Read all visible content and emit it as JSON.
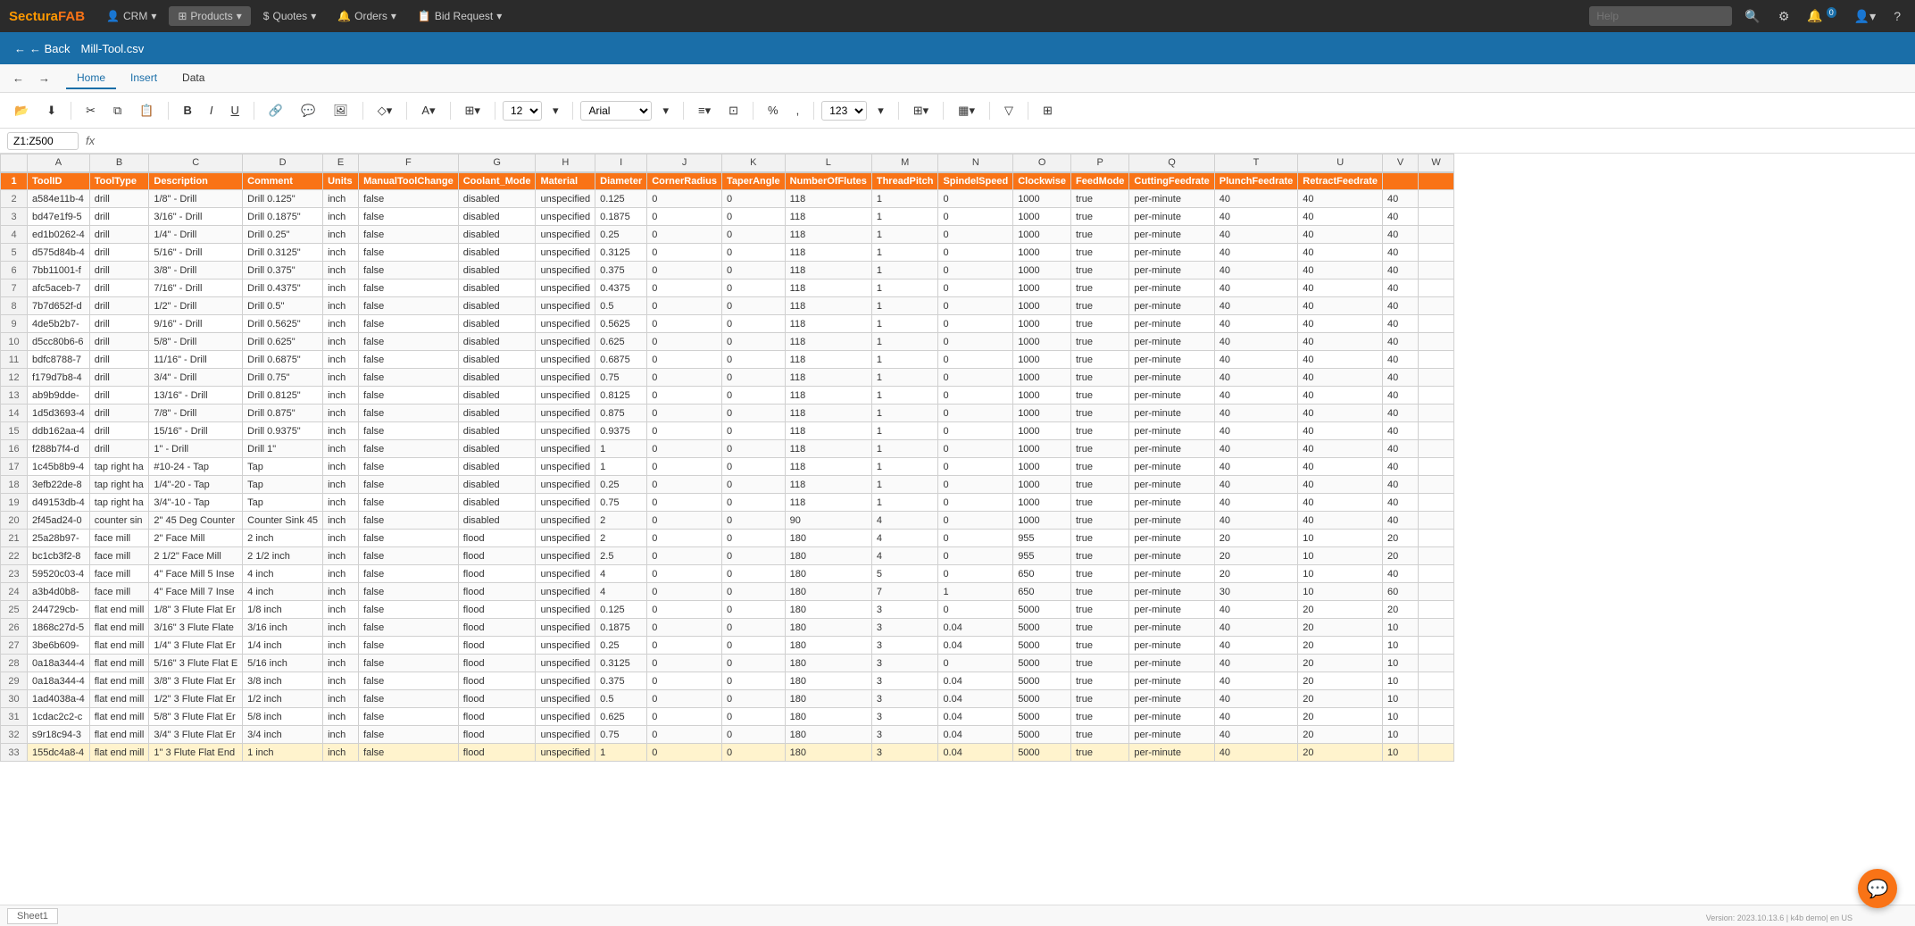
{
  "nav": {
    "logo_text": "Sectura",
    "logo_accent": "FAB",
    "items": [
      {
        "label": "CRM",
        "icon": "▾"
      },
      {
        "label": "Products",
        "icon": "▾"
      },
      {
        "label": "Quotes",
        "icon": "▾"
      },
      {
        "label": "Orders",
        "icon": "▾"
      },
      {
        "label": "Bid Request",
        "icon": "▾"
      }
    ],
    "search_placeholder": "Help",
    "notification_count": "0"
  },
  "breadcrumb": {
    "back_label": "← Back",
    "file_name": "Mill-Tool.csv"
  },
  "ribbon": {
    "tabs": [
      "Home",
      "Insert",
      "Data"
    ],
    "active_tab": "Home"
  },
  "formula_bar": {
    "cell_ref": "Z1:Z500",
    "fx": "fx"
  },
  "columns": {
    "letters": [
      "A",
      "B",
      "C",
      "D",
      "E",
      "F",
      "G",
      "H",
      "I",
      "J",
      "K",
      "L",
      "M",
      "N",
      "O",
      "P",
      "Q",
      "T",
      "U",
      "V",
      "W"
    ],
    "headers": [
      "ToolID",
      "ToolType",
      "Description",
      "Comment",
      "Units",
      "ManualToolChange",
      "Coolant_Mode",
      "Material",
      "Diameter",
      "CornerRadius",
      "TaperAngle",
      "NumberOfFlutes",
      "ThreadPitch",
      "SpindelSpeed",
      "Clockwise",
      "FeedMode",
      "CuttingFeedrate",
      "PlunchFeedrate",
      "RetractFeedrate",
      "",
      ""
    ]
  },
  "rows": [
    {
      "num": 2,
      "a": "a584e11b-4",
      "b": "drill",
      "c": "1/8\" - Drill",
      "d": "Drill 0.125\"",
      "e": "inch",
      "f": "false",
      "g": "disabled",
      "h": "unspecified",
      "i": "0.125",
      "j": "0",
      "k": "0",
      "l": "118",
      "m": "1",
      "n": "0",
      "o": "1000",
      "p": "true",
      "q": "per-minute",
      "t": "40",
      "u": "40",
      "v": "40"
    },
    {
      "num": 3,
      "a": "bd47e1f9-5",
      "b": "drill",
      "c": "3/16\" - Drill",
      "d": "Drill 0.1875\"",
      "e": "inch",
      "f": "false",
      "g": "disabled",
      "h": "unspecified",
      "i": "0.1875",
      "j": "0",
      "k": "0",
      "l": "118",
      "m": "1",
      "n": "0",
      "o": "1000",
      "p": "true",
      "q": "per-minute",
      "t": "40",
      "u": "40",
      "v": "40"
    },
    {
      "num": 4,
      "a": "ed1b0262-4",
      "b": "drill",
      "c": "1/4\" - Drill",
      "d": "Drill 0.25\"",
      "e": "inch",
      "f": "false",
      "g": "disabled",
      "h": "unspecified",
      "i": "0.25",
      "j": "0",
      "k": "0",
      "l": "118",
      "m": "1",
      "n": "0",
      "o": "1000",
      "p": "true",
      "q": "per-minute",
      "t": "40",
      "u": "40",
      "v": "40"
    },
    {
      "num": 5,
      "a": "d575d84b-4",
      "b": "drill",
      "c": "5/16\" - Drill",
      "d": "Drill 0.3125\"",
      "e": "inch",
      "f": "false",
      "g": "disabled",
      "h": "unspecified",
      "i": "0.3125",
      "j": "0",
      "k": "0",
      "l": "118",
      "m": "1",
      "n": "0",
      "o": "1000",
      "p": "true",
      "q": "per-minute",
      "t": "40",
      "u": "40",
      "v": "40"
    },
    {
      "num": 6,
      "a": "7bb11001-f",
      "b": "drill",
      "c": "3/8\" - Drill",
      "d": "Drill 0.375\"",
      "e": "inch",
      "f": "false",
      "g": "disabled",
      "h": "unspecified",
      "i": "0.375",
      "j": "0",
      "k": "0",
      "l": "118",
      "m": "1",
      "n": "0",
      "o": "1000",
      "p": "true",
      "q": "per-minute",
      "t": "40",
      "u": "40",
      "v": "40"
    },
    {
      "num": 7,
      "a": "afc5aceb-7",
      "b": "drill",
      "c": "7/16\" - Drill",
      "d": "Drill 0.4375\"",
      "e": "inch",
      "f": "false",
      "g": "disabled",
      "h": "unspecified",
      "i": "0.4375",
      "j": "0",
      "k": "0",
      "l": "118",
      "m": "1",
      "n": "0",
      "o": "1000",
      "p": "true",
      "q": "per-minute",
      "t": "40",
      "u": "40",
      "v": "40"
    },
    {
      "num": 8,
      "a": "7b7d652f-d",
      "b": "drill",
      "c": "1/2\" - Drill",
      "d": "Drill 0.5\"",
      "e": "inch",
      "f": "false",
      "g": "disabled",
      "h": "unspecified",
      "i": "0.5",
      "j": "0",
      "k": "0",
      "l": "118",
      "m": "1",
      "n": "0",
      "o": "1000",
      "p": "true",
      "q": "per-minute",
      "t": "40",
      "u": "40",
      "v": "40"
    },
    {
      "num": 9,
      "a": "4de5b2b7-",
      "b": "drill",
      "c": "9/16\" - Drill",
      "d": "Drill 0.5625\"",
      "e": "inch",
      "f": "false",
      "g": "disabled",
      "h": "unspecified",
      "i": "0.5625",
      "j": "0",
      "k": "0",
      "l": "118",
      "m": "1",
      "n": "0",
      "o": "1000",
      "p": "true",
      "q": "per-minute",
      "t": "40",
      "u": "40",
      "v": "40"
    },
    {
      "num": 10,
      "a": "d5cc80b6-6",
      "b": "drill",
      "c": "5/8\" - Drill",
      "d": "Drill 0.625\"",
      "e": "inch",
      "f": "false",
      "g": "disabled",
      "h": "unspecified",
      "i": "0.625",
      "j": "0",
      "k": "0",
      "l": "118",
      "m": "1",
      "n": "0",
      "o": "1000",
      "p": "true",
      "q": "per-minute",
      "t": "40",
      "u": "40",
      "v": "40"
    },
    {
      "num": 11,
      "a": "bdfc8788-7",
      "b": "drill",
      "c": "11/16\" - Drill",
      "d": "Drill 0.6875\"",
      "e": "inch",
      "f": "false",
      "g": "disabled",
      "h": "unspecified",
      "i": "0.6875",
      "j": "0",
      "k": "0",
      "l": "118",
      "m": "1",
      "n": "0",
      "o": "1000",
      "p": "true",
      "q": "per-minute",
      "t": "40",
      "u": "40",
      "v": "40"
    },
    {
      "num": 12,
      "a": "f179d7b8-4",
      "b": "drill",
      "c": "3/4\" - Drill",
      "d": "Drill 0.75\"",
      "e": "inch",
      "f": "false",
      "g": "disabled",
      "h": "unspecified",
      "i": "0.75",
      "j": "0",
      "k": "0",
      "l": "118",
      "m": "1",
      "n": "0",
      "o": "1000",
      "p": "true",
      "q": "per-minute",
      "t": "40",
      "u": "40",
      "v": "40"
    },
    {
      "num": 13,
      "a": "ab9b9dde-",
      "b": "drill",
      "c": "13/16\" - Drill",
      "d": "Drill 0.8125\"",
      "e": "inch",
      "f": "false",
      "g": "disabled",
      "h": "unspecified",
      "i": "0.8125",
      "j": "0",
      "k": "0",
      "l": "118",
      "m": "1",
      "n": "0",
      "o": "1000",
      "p": "true",
      "q": "per-minute",
      "t": "40",
      "u": "40",
      "v": "40"
    },
    {
      "num": 14,
      "a": "1d5d3693-4",
      "b": "drill",
      "c": "7/8\" - Drill",
      "d": "Drill 0.875\"",
      "e": "inch",
      "f": "false",
      "g": "disabled",
      "h": "unspecified",
      "i": "0.875",
      "j": "0",
      "k": "0",
      "l": "118",
      "m": "1",
      "n": "0",
      "o": "1000",
      "p": "true",
      "q": "per-minute",
      "t": "40",
      "u": "40",
      "v": "40"
    },
    {
      "num": 15,
      "a": "ddb162aa-4",
      "b": "drill",
      "c": "15/16\" - Drill",
      "d": "Drill 0.9375\"",
      "e": "inch",
      "f": "false",
      "g": "disabled",
      "h": "unspecified",
      "i": "0.9375",
      "j": "0",
      "k": "0",
      "l": "118",
      "m": "1",
      "n": "0",
      "o": "1000",
      "p": "true",
      "q": "per-minute",
      "t": "40",
      "u": "40",
      "v": "40"
    },
    {
      "num": 16,
      "a": "f288b7f4-d",
      "b": "drill",
      "c": "1\" - Drill",
      "d": "Drill 1\"",
      "e": "inch",
      "f": "false",
      "g": "disabled",
      "h": "unspecified",
      "i": "1",
      "j": "0",
      "k": "0",
      "l": "118",
      "m": "1",
      "n": "0",
      "o": "1000",
      "p": "true",
      "q": "per-minute",
      "t": "40",
      "u": "40",
      "v": "40"
    },
    {
      "num": 17,
      "a": "1c45b8b9-4",
      "b": "tap right ha",
      "c": "#10-24 - Tap",
      "d": "Tap",
      "e": "inch",
      "f": "false",
      "g": "disabled",
      "h": "unspecified",
      "i": "1",
      "j": "0",
      "k": "0",
      "l": "118",
      "m": "1",
      "n": "0",
      "o": "1000",
      "p": "true",
      "q": "per-minute",
      "t": "40",
      "u": "40",
      "v": "40"
    },
    {
      "num": 18,
      "a": "3efb22de-8",
      "b": "tap right ha",
      "c": "1/4\"-20 - Tap",
      "d": "Tap",
      "e": "inch",
      "f": "false",
      "g": "disabled",
      "h": "unspecified",
      "i": "0.25",
      "j": "0",
      "k": "0",
      "l": "118",
      "m": "1",
      "n": "0",
      "o": "1000",
      "p": "true",
      "q": "per-minute",
      "t": "40",
      "u": "40",
      "v": "40"
    },
    {
      "num": 19,
      "a": "d49153db-4",
      "b": "tap right ha",
      "c": "3/4\"-10 - Tap",
      "d": "Tap",
      "e": "inch",
      "f": "false",
      "g": "disabled",
      "h": "unspecified",
      "i": "0.75",
      "j": "0",
      "k": "0",
      "l": "118",
      "m": "1",
      "n": "0",
      "o": "1000",
      "p": "true",
      "q": "per-minute",
      "t": "40",
      "u": "40",
      "v": "40"
    },
    {
      "num": 20,
      "a": "2f45ad24-0",
      "b": "counter sin",
      "c": "2\" 45 Deg Counter",
      "d": "Counter Sink 45",
      "e": "inch",
      "f": "false",
      "g": "disabled",
      "h": "unspecified",
      "i": "2",
      "j": "0",
      "k": "0",
      "l": "90",
      "m": "4",
      "n": "0",
      "o": "1000",
      "p": "true",
      "q": "per-minute",
      "t": "40",
      "u": "40",
      "v": "40"
    },
    {
      "num": 21,
      "a": "25a28b97-",
      "b": "face mill",
      "c": "2\" Face Mill",
      "d": "2 inch",
      "e": "inch",
      "f": "false",
      "g": "flood",
      "h": "unspecified",
      "i": "2",
      "j": "0",
      "k": "0",
      "l": "180",
      "m": "4",
      "n": "0",
      "o": "955",
      "p": "true",
      "q": "per-minute",
      "t": "20",
      "u": "10",
      "v": "20"
    },
    {
      "num": 22,
      "a": "bc1cb3f2-8",
      "b": "face mill",
      "c": "2 1/2\" Face Mill",
      "d": "2 1/2 inch",
      "e": "inch",
      "f": "false",
      "g": "flood",
      "h": "unspecified",
      "i": "2.5",
      "j": "0",
      "k": "0",
      "l": "180",
      "m": "4",
      "n": "0",
      "o": "955",
      "p": "true",
      "q": "per-minute",
      "t": "20",
      "u": "10",
      "v": "20"
    },
    {
      "num": 23,
      "a": "59520c03-4",
      "b": "face mill",
      "c": "4\" Face Mill 5 Inse",
      "d": "4 inch",
      "e": "inch",
      "f": "false",
      "g": "flood",
      "h": "unspecified",
      "i": "4",
      "j": "0",
      "k": "0",
      "l": "180",
      "m": "5",
      "n": "0",
      "o": "650",
      "p": "true",
      "q": "per-minute",
      "t": "20",
      "u": "10",
      "v": "40"
    },
    {
      "num": 24,
      "a": "a3b4d0b8-",
      "b": "face mill",
      "c": "4\" Face Mill 7 Inse",
      "d": "4 inch",
      "e": "inch",
      "f": "false",
      "g": "flood",
      "h": "unspecified",
      "i": "4",
      "j": "0",
      "k": "0",
      "l": "180",
      "m": "7",
      "n": "1",
      "o": "650",
      "p": "true",
      "q": "per-minute",
      "t": "30",
      "u": "10",
      "v": "60"
    },
    {
      "num": 25,
      "a": "244729cb-",
      "b": "flat end mill",
      "c": "1/8\" 3 Flute Flat Er",
      "d": "1/8 inch",
      "e": "inch",
      "f": "false",
      "g": "flood",
      "h": "unspecified",
      "i": "0.125",
      "j": "0",
      "k": "0",
      "l": "180",
      "m": "3",
      "n": "0",
      "o": "5000",
      "p": "true",
      "q": "per-minute",
      "t": "40",
      "u": "20",
      "v": "20"
    },
    {
      "num": 26,
      "a": "1868c27d-5",
      "b": "flat end mill",
      "c": "3/16\" 3 Flute Flate",
      "d": "3/16 inch",
      "e": "inch",
      "f": "false",
      "g": "flood",
      "h": "unspecified",
      "i": "0.1875",
      "j": "0",
      "k": "0",
      "l": "180",
      "m": "3",
      "n": "0.04",
      "o": "5000",
      "p": "true",
      "q": "per-minute",
      "t": "40",
      "u": "20",
      "v": "10"
    },
    {
      "num": 27,
      "a": "3be6b609-",
      "b": "flat end mill",
      "c": "1/4\" 3 Flute Flat Er",
      "d": "1/4 inch",
      "e": "inch",
      "f": "false",
      "g": "flood",
      "h": "unspecified",
      "i": "0.25",
      "j": "0",
      "k": "0",
      "l": "180",
      "m": "3",
      "n": "0.04",
      "o": "5000",
      "p": "true",
      "q": "per-minute",
      "t": "40",
      "u": "20",
      "v": "10"
    },
    {
      "num": 28,
      "a": "0a18a344-4",
      "b": "flat end mill",
      "c": "5/16\" 3 Flute Flat E",
      "d": "5/16 inch",
      "e": "inch",
      "f": "false",
      "g": "flood",
      "h": "unspecified",
      "i": "0.3125",
      "j": "0",
      "k": "0",
      "l": "180",
      "m": "3",
      "n": "0",
      "o": "5000",
      "p": "true",
      "q": "per-minute",
      "t": "40",
      "u": "20",
      "v": "10"
    },
    {
      "num": 29,
      "a": "0a18a344-4",
      "b": "flat end mill",
      "c": "3/8\" 3 Flute Flat Er",
      "d": "3/8 inch",
      "e": "inch",
      "f": "false",
      "g": "flood",
      "h": "unspecified",
      "i": "0.375",
      "j": "0",
      "k": "0",
      "l": "180",
      "m": "3",
      "n": "0.04",
      "o": "5000",
      "p": "true",
      "q": "per-minute",
      "t": "40",
      "u": "20",
      "v": "10"
    },
    {
      "num": 30,
      "a": "1ad4038a-4",
      "b": "flat end mill",
      "c": "1/2\" 3 Flute Flat Er",
      "d": "1/2 inch",
      "e": "inch",
      "f": "false",
      "g": "flood",
      "h": "unspecified",
      "i": "0.5",
      "j": "0",
      "k": "0",
      "l": "180",
      "m": "3",
      "n": "0.04",
      "o": "5000",
      "p": "true",
      "q": "per-minute",
      "t": "40",
      "u": "20",
      "v": "10"
    },
    {
      "num": 31,
      "a": "1cdac2c2-c",
      "b": "flat end mill",
      "c": "5/8\" 3 Flute Flat Er",
      "d": "5/8 inch",
      "e": "inch",
      "f": "false",
      "g": "flood",
      "h": "unspecified",
      "i": "0.625",
      "j": "0",
      "k": "0",
      "l": "180",
      "m": "3",
      "n": "0.04",
      "o": "5000",
      "p": "true",
      "q": "per-minute",
      "t": "40",
      "u": "20",
      "v": "10"
    },
    {
      "num": 32,
      "a": "s9r18c94-3",
      "b": "flat end mill",
      "c": "3/4\" 3 Flute Flat Er",
      "d": "3/4 inch",
      "e": "inch",
      "f": "false",
      "g": "flood",
      "h": "unspecified",
      "i": "0.75",
      "j": "0",
      "k": "0",
      "l": "180",
      "m": "3",
      "n": "0.04",
      "o": "5000",
      "p": "true",
      "q": "per-minute",
      "t": "40",
      "u": "20",
      "v": "10"
    },
    {
      "num": 33,
      "a": "155dc4a8-4",
      "b": "flat end mill",
      "c": "1\" 3 Flute Flat End",
      "d": "1 inch",
      "e": "inch",
      "f": "false",
      "g": "flood",
      "h": "unspecified",
      "i": "1",
      "j": "0",
      "k": "0",
      "l": "180",
      "m": "3",
      "n": "0.04",
      "o": "5000",
      "p": "true",
      "q": "per-minute",
      "t": "40",
      "u": "20",
      "v": "10"
    }
  ],
  "version": "Version: 2023.10.13.6 | k4b demo| en US"
}
